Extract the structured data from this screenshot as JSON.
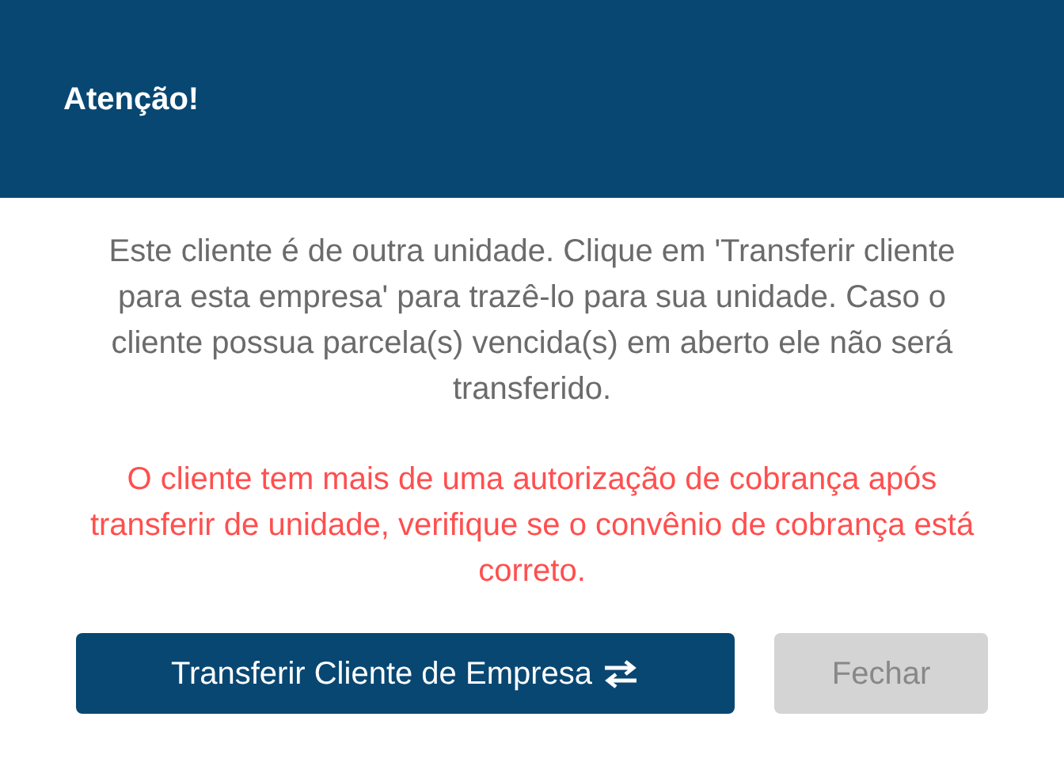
{
  "dialog": {
    "title": "Atenção!",
    "message": "Este cliente é de outra unidade. Clique em 'Transferir cliente para esta empresa' para trazê-lo para sua unidade. Caso o cliente possua parcela(s) vencida(s) em aberto ele não será transferido.",
    "warning": "O cliente tem mais de uma autorização de cobrança após transferir de unidade, verifique se o convênio de cobrança está correto.",
    "buttons": [
      {
        "label": "Transferir Cliente de Empresa",
        "kind": "primary"
      },
      {
        "label": "Fechar",
        "kind": "secondary"
      }
    ]
  }
}
